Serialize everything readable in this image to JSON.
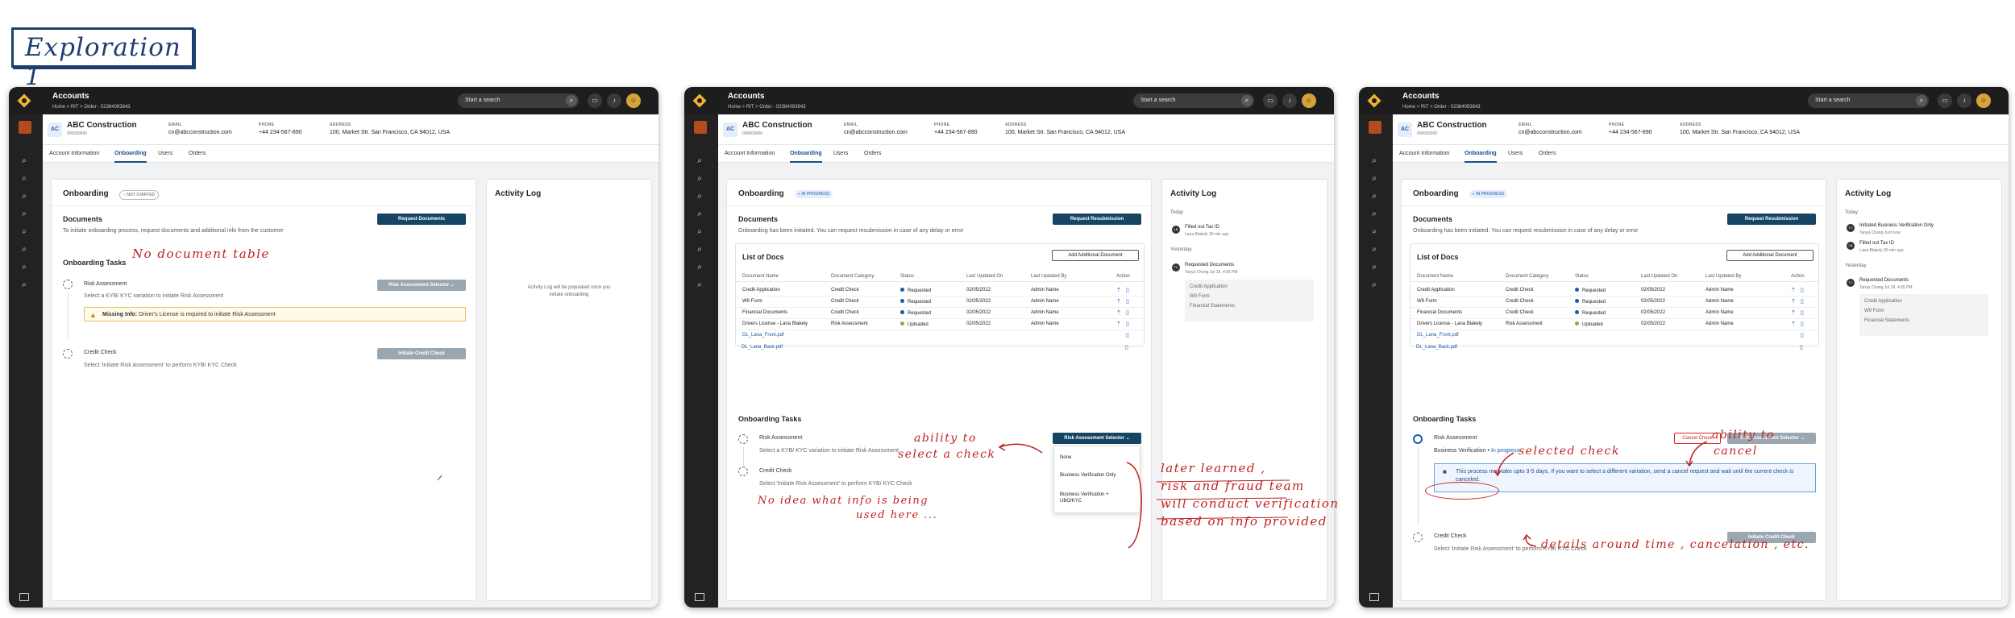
{
  "title": "Exploration 1",
  "topbar": {
    "title": "Accounts",
    "breadcrumb": "Home  >  RIT  >  Order - 02384093843",
    "search_placeholder": "Start a search"
  },
  "account": {
    "initials": "AC",
    "name": "ABC Construction",
    "id": "000000000",
    "email_label": "EMAIL",
    "email": "cn@abcconstruction.com",
    "phone_label": "PHONE",
    "phone": "+44 234-567-890",
    "address_label": "ADDRESS",
    "address": "100, Market Str. San Francisco, CA 94012, USA"
  },
  "tabs": [
    "Account Information",
    "Onboarding",
    "Users",
    "Orders"
  ],
  "onboarding": {
    "title": "Onboarding",
    "status_not_started": "NOT STARTED",
    "status_in_progress": "IN PROGRESS"
  },
  "documents": {
    "title": "Documents",
    "desc_initial": "To initiate onboarding process, request documents and additional info from the customer",
    "desc_initiated": "Onboarding has been initiated. You can request resubmission in case of any delay or error",
    "request_docs": "Request Documents",
    "request_resub": "Request Resubmission"
  },
  "tasks": {
    "title": "Onboarding Tasks",
    "risk": "Risk Assessment",
    "risk_desc": "Select a KYB/ KYC variation to initiate Risk Assessment",
    "risk_selector": "Risk Assessment Selector",
    "missing_bold": "Missing Info:",
    "missing_text": "Driver's License is required to initiate Risk Assessment",
    "credit": "Credit Check",
    "credit_desc": "Select 'Initiate Risk Assessment' to perform KYB/ KYC Check",
    "initiate_credit": "Initiate Credit Check",
    "cancel_check": "Cancel Check",
    "bv_label": "Business Verification",
    "bv_status": "In progress",
    "info": "This process may take upto 3-5 days. If you want to select a different variation, send a cancel request and wait until the current check is canceled."
  },
  "dropdown": {
    "items": [
      "None",
      "Business Verification Only",
      "Business Verification + UBO/KYC"
    ]
  },
  "docs_table": {
    "title": "List of Docs",
    "add_button": "Add Additional Document",
    "headers": [
      "Document Name",
      "Document Category",
      "Status",
      "Last Updated On",
      "Last Updated By",
      "Action"
    ],
    "rows": [
      {
        "name": "Credit Application",
        "category": "Credit Check",
        "status": "Requested",
        "date": "02/05/2022",
        "by": "Admin Name"
      },
      {
        "name": "W9 Form",
        "category": "Credit Check",
        "status": "Requested",
        "date": "02/05/2022",
        "by": "Admin Name"
      },
      {
        "name": "Financial Documents",
        "category": "Credit Check",
        "status": "Requested",
        "date": "02/05/2022",
        "by": "Admin Name"
      },
      {
        "name": "Drivers License - Lana Blakely",
        "category": "Risk Assessment",
        "status": "Uploaded",
        "date": "02/05/2022",
        "by": "Admin Name"
      }
    ],
    "files": [
      "DL_Lana_Front.pdf",
      "DL_Lana_Back.pdf"
    ]
  },
  "activity": {
    "title": "Activity Log",
    "empty": "Activity Log will be populated once you initiate onboarding",
    "today": "Today",
    "yesterday": "Yesterday",
    "f2_today": [
      {
        "initials": "LB",
        "title": "Filled out Tax ID",
        "sub": "Lana Blakely    30 min ago"
      }
    ],
    "f3_today": [
      {
        "initials": "TC",
        "title": "Initiated Business Verification Only",
        "sub": "Tanya Chang    Just now"
      },
      {
        "initials": "LB",
        "title": "Filled out Tax ID",
        "sub": "Lana Blakely    30 min ago"
      }
    ],
    "yesterday_item": {
      "initials": "TC",
      "title": "Requested Documents",
      "sub": "Tanya Chang    Jul 18, 4:05 PM"
    },
    "sub_items": [
      "Credit Application",
      "W9 Form",
      "Financial Statements"
    ]
  },
  "annotations": {
    "no_doc_table": "No document table",
    "ability_select": [
      "ability to",
      "select a check"
    ],
    "no_idea": [
      "No idea  what info is being",
      "used  here ..."
    ],
    "later_learned": [
      "later learned ,",
      "risk and fraud team",
      "will conduct verification",
      "based on info provided"
    ],
    "selected_check": "selected check",
    "ability_cancel": [
      "ability to",
      "cancel"
    ],
    "details": "details around time , cancelation , etc."
  },
  "colors": {
    "primary": "#154563",
    "accent": "#1a4f8a",
    "annotation": "#c0201f",
    "title": "#1d3f6f"
  }
}
